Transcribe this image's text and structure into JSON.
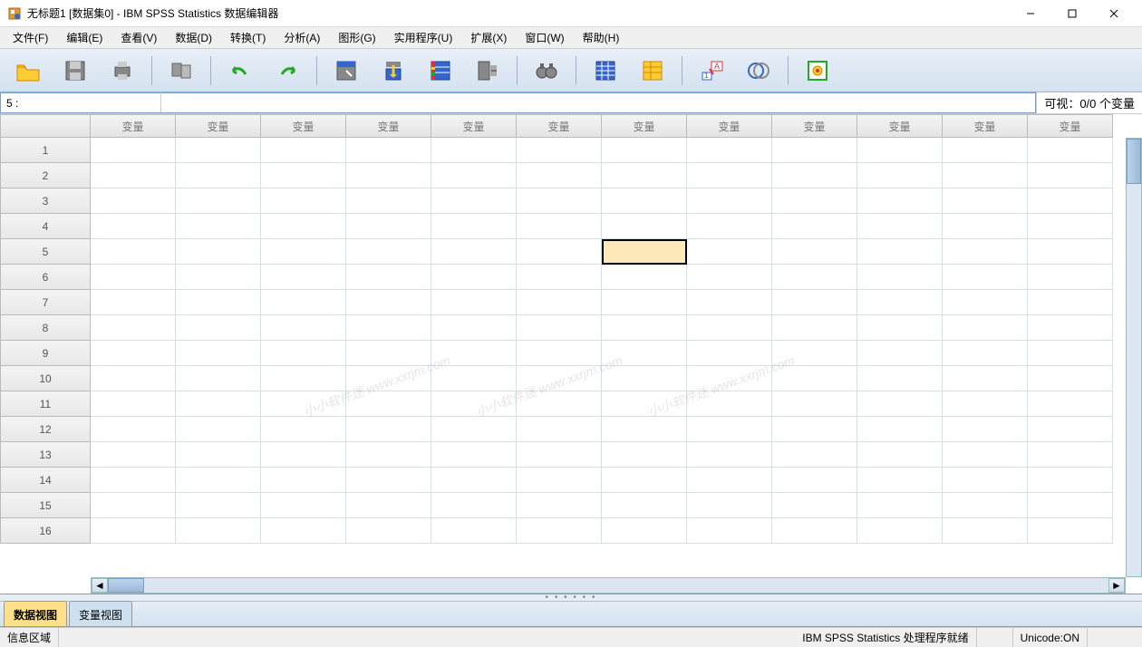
{
  "titlebar": {
    "title": "无标题1 [数据集0] - IBM SPSS Statistics 数据编辑器"
  },
  "menu": {
    "file": "文件(F)",
    "edit": "编辑(E)",
    "view": "查看(V)",
    "data": "数据(D)",
    "transform": "转换(T)",
    "analyze": "分析(A)",
    "graphs": "图形(G)",
    "utilities": "实用程序(U)",
    "extensions": "扩展(X)",
    "window": "窗口(W)",
    "help": "帮助(H)"
  },
  "refbar": {
    "cell": "5 :",
    "visible": "可视：0/0 个变量"
  },
  "grid": {
    "colheader": "变量",
    "rows": [
      1,
      2,
      3,
      4,
      5,
      6,
      7,
      8,
      9,
      10,
      11,
      12,
      13,
      14,
      15,
      16
    ],
    "selected_row": 5,
    "selected_col": 7
  },
  "viewtabs": {
    "data": "数据视图",
    "variable": "变量视图"
  },
  "statusbar": {
    "info": "信息区域",
    "processor": "IBM SPSS Statistics 处理程序就绪",
    "unicode": "Unicode:ON"
  },
  "watermark": "小小软件迷 www.xxrjm.com"
}
